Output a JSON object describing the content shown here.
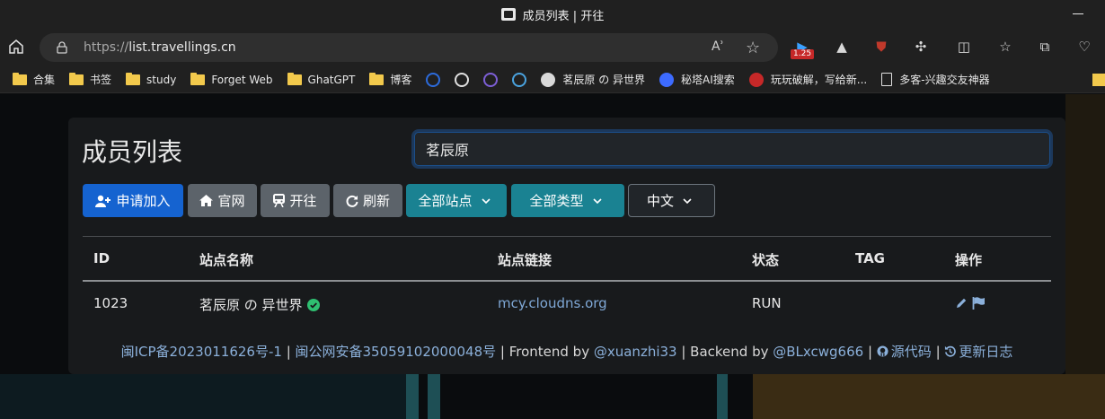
{
  "browser": {
    "window_title": "成员列表 | 开往",
    "url_protocol": "https://",
    "url_host": "list.travellings.cn",
    "read_aloud_label": "Aʾ",
    "extension_badge": "1.25",
    "bookmarks": [
      {
        "label": "合集",
        "icon": "folder-icon"
      },
      {
        "label": "书签",
        "icon": "folder-icon"
      },
      {
        "label": "study",
        "icon": "folder-icon"
      },
      {
        "label": "Forget Web",
        "icon": "folder-icon"
      },
      {
        "label": "GhatGPT",
        "icon": "folder-icon"
      },
      {
        "label": "博客",
        "icon": "folder-icon"
      },
      {
        "label": "茗辰原 の 异世界",
        "icon": "avatar-favicon"
      },
      {
        "label": "秘塔AI搜索",
        "icon": "metaso-favicon"
      },
      {
        "label": "玩玩破解，写给新...",
        "icon": "seal-favicon"
      },
      {
        "label": "多客-兴趣交友神器",
        "icon": "page-icon"
      }
    ]
  },
  "page": {
    "title": "成员列表",
    "search_value": "茗辰原",
    "buttons": {
      "apply": "申请加入",
      "official": "官网",
      "travel": "开往",
      "refresh": "刷新"
    },
    "selects": {
      "site_filter": "全部站点",
      "type_filter": "全部类型",
      "language": "中文"
    },
    "table": {
      "headers": [
        "ID",
        "站点名称",
        "站点链接",
        "状态",
        "TAG",
        "操作"
      ],
      "rows": [
        {
          "id": "1023",
          "name": "茗辰原 の 异世界",
          "link": "mcy.cloudns.org",
          "status": "RUN",
          "tag": ""
        }
      ]
    },
    "footer": {
      "icp": "闽ICP备2023011626号-1",
      "sep1": " | ",
      "police": "闽公网安备35059102000048号",
      "sep2": " | Frontend by ",
      "frontend": "@xuanzhi33",
      "sep3": " | Backend by ",
      "backend": "@BLxcwg666",
      "sep4": " | ",
      "source": "源代码",
      "sep5": " | ",
      "changelog": "更新日志"
    }
  },
  "colors": {
    "primary": "#1563d0",
    "secondary": "#5c636a",
    "teal": "#1a8292",
    "link": "#7fa8d6",
    "verified": "#2fbf71"
  }
}
